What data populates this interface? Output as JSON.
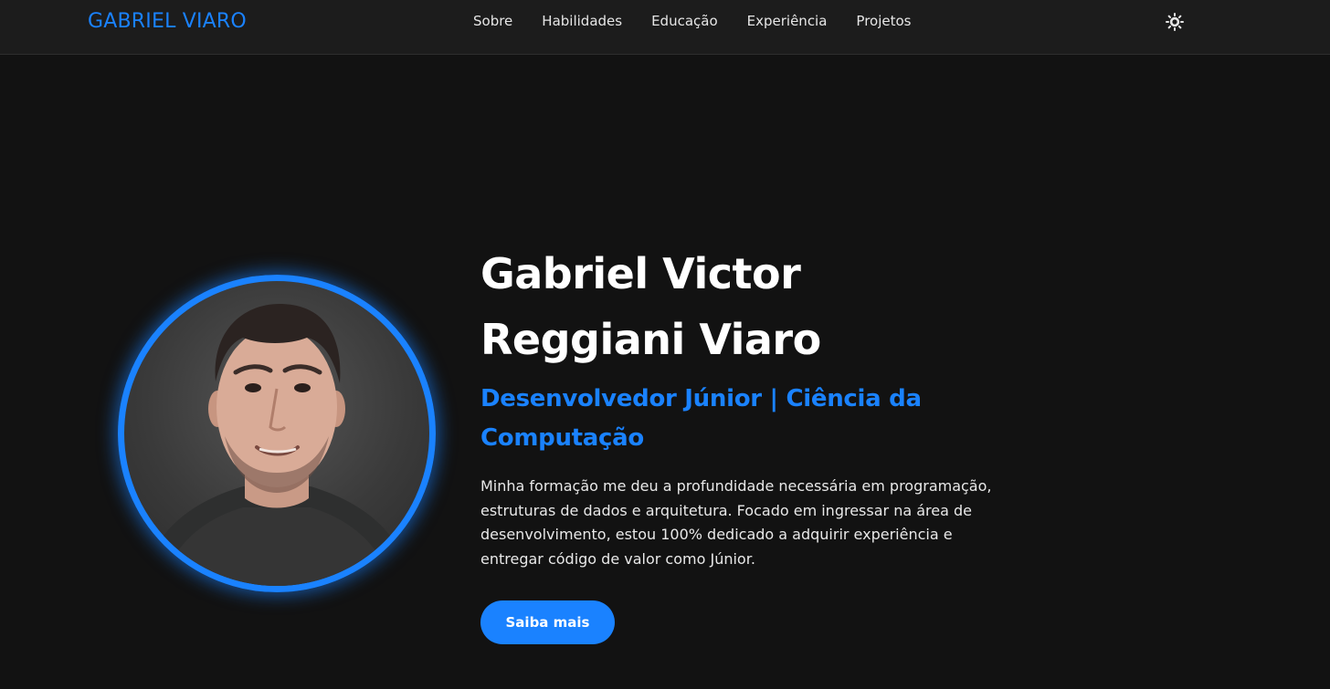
{
  "navbar": {
    "brand": "GABRIEL VIARO",
    "links": [
      "Sobre",
      "Habilidades",
      "Educação",
      "Experiência",
      "Projetos"
    ],
    "theme_toggle_icon": "sun-icon"
  },
  "hero": {
    "name_line1": "Gabriel Victor",
    "name_line2": "Reggiani Viaro",
    "role": "Desenvolvedor Júnior | Ciência da Computação",
    "description": "Minha formação me deu a profundidade necessária em programação, estruturas de dados e arquitetura. Focado em ingressar na área de desenvolvimento, estou 100% dedicado a adquirir experiência e entregar código de valor como Júnior.",
    "cta_label": "Saiba mais",
    "avatar_icon": "profile-photo"
  },
  "colors": {
    "background": "#121212",
    "navbar": "#1c1c1c",
    "accent": "#1a82ff",
    "text": "#ffffff"
  }
}
